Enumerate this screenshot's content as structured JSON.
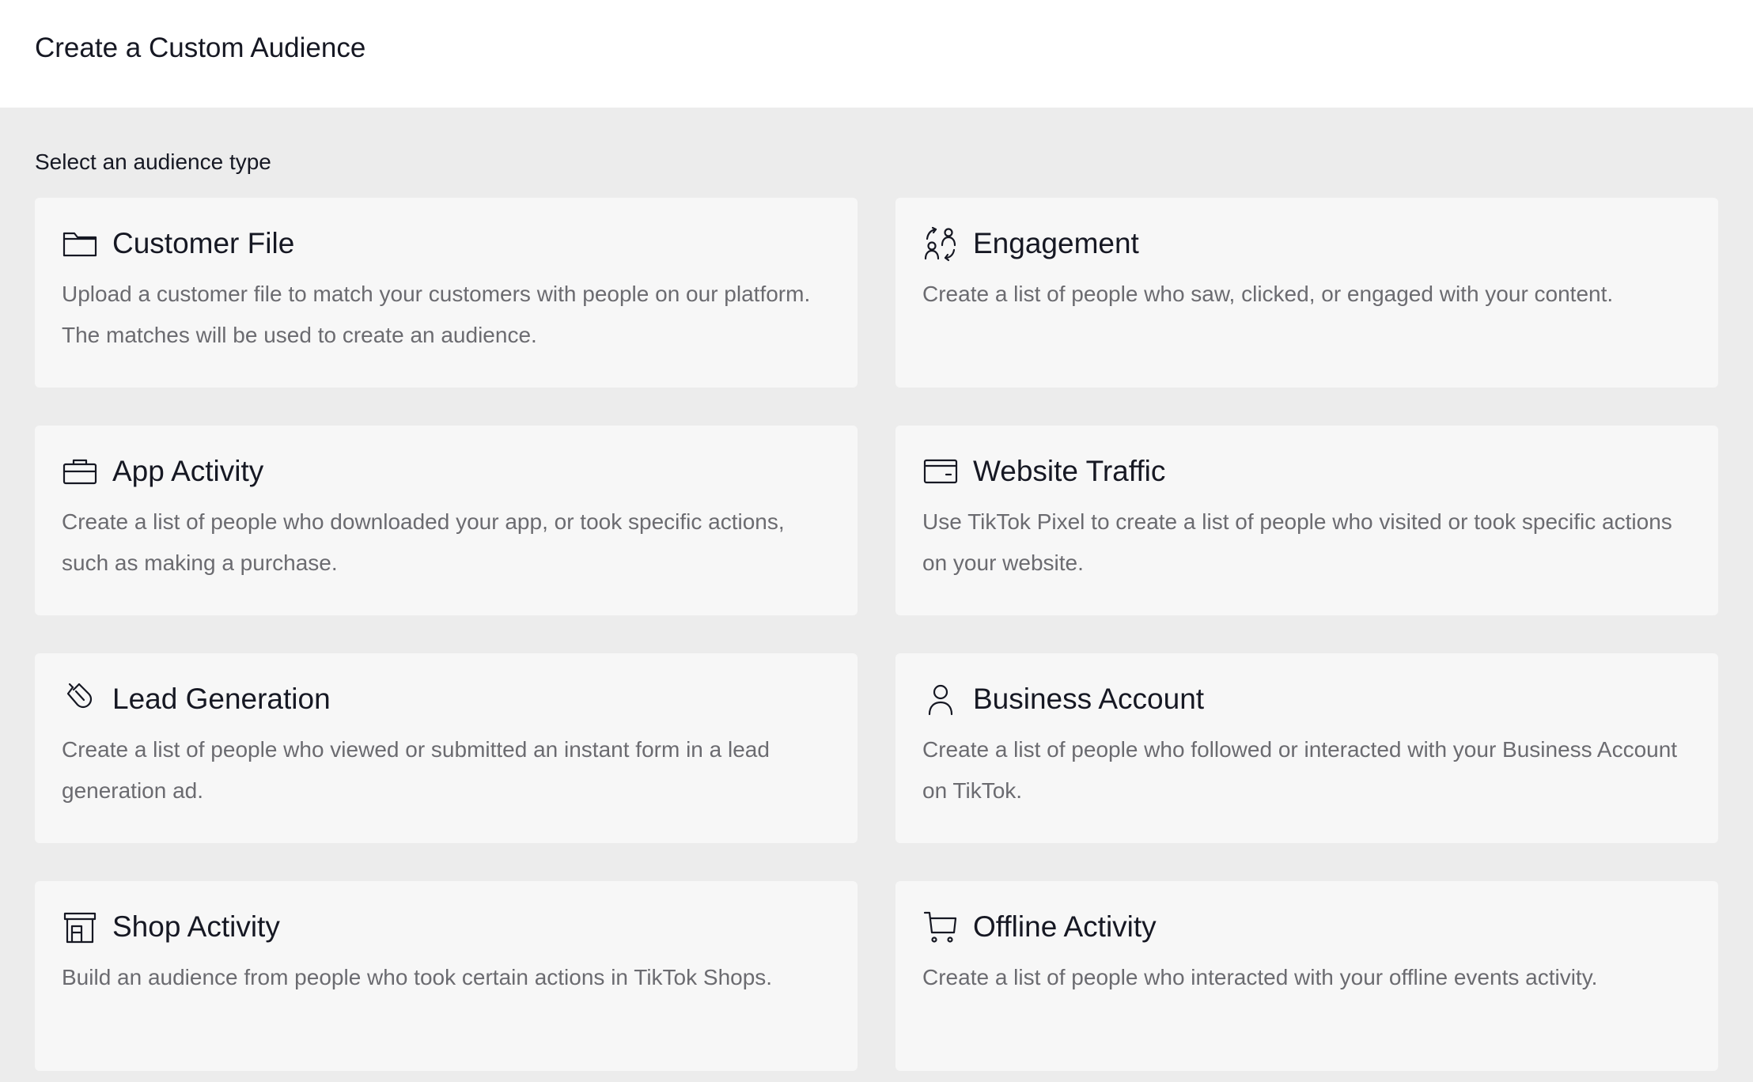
{
  "header": {
    "title": "Create a Custom Audience"
  },
  "main": {
    "section_label": "Select an audience type",
    "cards": [
      {
        "title": "Customer File",
        "description": "Upload a customer file to match your customers with people on our platform. The matches will be used to create an audience.",
        "icon": "folder-icon"
      },
      {
        "title": "Engagement",
        "description": "Create a list of people who saw, clicked, or engaged with your content.",
        "icon": "engagement-icon"
      },
      {
        "title": "App Activity",
        "description": "Create a list of people who downloaded your app, or took specific actions, such as making a purchase.",
        "icon": "briefcase-icon"
      },
      {
        "title": "Website Traffic",
        "description": "Use TikTok Pixel to create a list of people who visited or took specific actions on your website.",
        "icon": "browser-window-icon"
      },
      {
        "title": "Lead Generation",
        "description": "Create a list of people who viewed or submitted an instant form in a lead generation ad.",
        "icon": "magnet-icon"
      },
      {
        "title": "Business Account",
        "description": "Create a list of people who followed or interacted with your Business Account on TikTok.",
        "icon": "person-icon"
      },
      {
        "title": "Shop Activity",
        "description": "Build an audience from people who took certain actions in TikTok Shops.",
        "icon": "storefront-icon"
      },
      {
        "title": "Offline Activity",
        "description": "Create a list of people who interacted with your offline events activity.",
        "icon": "shopping-cart-icon"
      }
    ]
  }
}
